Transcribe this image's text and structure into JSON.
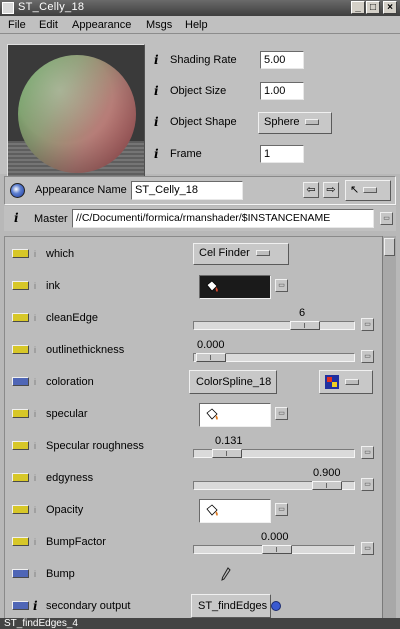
{
  "window": {
    "title": "ST_Celly_18"
  },
  "menu": [
    "File",
    "Edit",
    "Appearance",
    "Msgs",
    "Help"
  ],
  "render_params": [
    {
      "label": "Shading Rate",
      "value": "5.00"
    },
    {
      "label": "Object Size",
      "value": "1.00"
    },
    {
      "label": "Object Shape",
      "value": "Sphere"
    },
    {
      "label": "Frame",
      "value": "1"
    }
  ],
  "appearance": {
    "label": "Appearance Name",
    "value": "ST_Celly_18"
  },
  "master": {
    "label": "Master",
    "value": "//C/Documenti/formica/rmanshader/$INSTANCENAME"
  },
  "params": [
    {
      "label": "which",
      "control": "dropdown",
      "value": "Cel Finder",
      "chip": "#d7c728"
    },
    {
      "label": "ink",
      "control": "color",
      "color": "#1a1a1a",
      "chip": "#d7c728"
    },
    {
      "label": "cleanEdge",
      "control": "slider",
      "value": "6",
      "fraction": 0.78,
      "chip": "#d7c728"
    },
    {
      "label": "outlinethickness",
      "control": "slider",
      "value": "0.000",
      "fraction": 0.0,
      "chip": "#d7c728"
    },
    {
      "label": "coloration",
      "control": "button",
      "value": "ColorSpline_18",
      "chip": "#4f66b6"
    },
    {
      "label": "specular",
      "control": "color",
      "color": "#ffffff",
      "chip": "#d7c728"
    },
    {
      "label": "Specular roughness",
      "control": "slider",
      "value": "0.131",
      "fraction": 0.13,
      "chip": "#d7c728"
    },
    {
      "label": "edgyness",
      "control": "slider",
      "value": "0.900",
      "fraction": 0.9,
      "chip": "#d7c728"
    },
    {
      "label": "Opacity",
      "control": "color",
      "color": "#ffffff",
      "chip": "#d7c728"
    },
    {
      "label": "BumpFactor",
      "control": "slider",
      "value": "0.000",
      "fraction": 0.5,
      "chip": "#d7c728"
    },
    {
      "label": "Bump",
      "control": "pencil",
      "chip": "#4f66b6"
    },
    {
      "label": "secondary output",
      "control": "button",
      "value": "ST_findEdges",
      "chip": "#4f66b6"
    }
  ],
  "bottom": {
    "text": "ST_findEdges_4"
  },
  "icons": {
    "arrow_left": "arrow-left-icon",
    "arrow_right": "arrow-right-icon",
    "pointer": "pointer-icon",
    "paint_bucket": "paint-bucket-icon",
    "pencil": "pencil-icon",
    "globe": "globe-icon"
  }
}
